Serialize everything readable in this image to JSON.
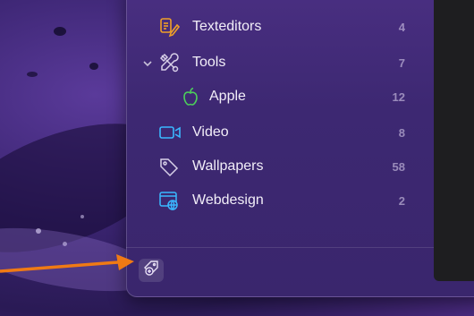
{
  "sidebar": {
    "items": [
      {
        "label": "Texteditors",
        "count": "4",
        "icon": "texteditor-icon",
        "color": "#f0a028"
      },
      {
        "label": "Tools",
        "count": "7",
        "icon": "tools-icon",
        "color": "#d8d0e8",
        "expanded": true
      },
      {
        "label": "Apple",
        "count": "12",
        "icon": "apple-icon",
        "color": "#4cd05a",
        "child": true
      },
      {
        "label": "Video",
        "count": "8",
        "icon": "video-icon",
        "color": "#3ab8ff"
      },
      {
        "label": "Wallpapers",
        "count": "58",
        "icon": "tag-icon",
        "color": "#d8d0e8"
      },
      {
        "label": "Webdesign",
        "count": "2",
        "icon": "webdesign-icon",
        "color": "#3ab8ff"
      }
    ]
  },
  "footer": {
    "add_button_icon": "add-tag-icon"
  },
  "annotation": {
    "arrow_color": "#f07a14",
    "callout_color": "#f3d6a6"
  }
}
